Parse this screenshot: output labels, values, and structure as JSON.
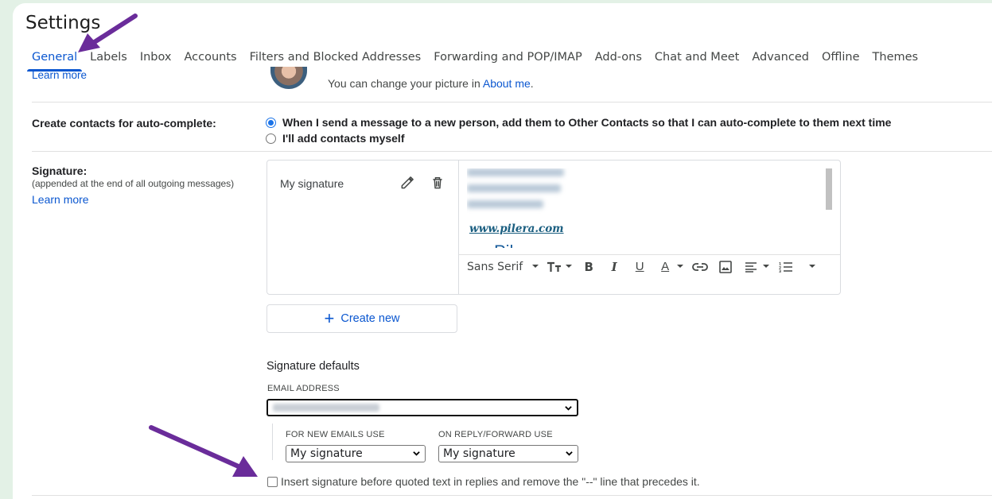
{
  "header": {
    "title": "Settings"
  },
  "tabs": [
    {
      "label": "General",
      "active": true
    },
    {
      "label": "Labels"
    },
    {
      "label": "Inbox"
    },
    {
      "label": "Accounts"
    },
    {
      "label": "Filters and Blocked Addresses"
    },
    {
      "label": "Forwarding and POP/IMAP"
    },
    {
      "label": "Add-ons"
    },
    {
      "label": "Chat and Meet"
    },
    {
      "label": "Advanced"
    },
    {
      "label": "Offline"
    },
    {
      "label": "Themes"
    }
  ],
  "picture": {
    "learn_more": "Learn more",
    "change_text": "You can change your picture in ",
    "about_me": "About me",
    "period": "."
  },
  "autocomplete": {
    "label": "Create contacts for auto-complete:",
    "option_auto": "When I send a message to a new person, add them to Other Contacts so that I can auto-complete to them next time",
    "option_manual": "I'll add contacts myself"
  },
  "signature": {
    "label": "Signature:",
    "sublabel": "(appended at the end of all outgoing messages)",
    "learn_more": "Learn more",
    "item_name": "My signature",
    "website": "www.pilera.com",
    "logo_text": "Pilera",
    "font_name": "Sans Serif",
    "create_new": "Create new"
  },
  "defaults": {
    "title": "Signature defaults",
    "email_label": "EMAIL ADDRESS",
    "new_label": "FOR NEW EMAILS USE",
    "reply_label": "ON REPLY/FORWARD USE",
    "new_value": "My signature",
    "reply_value": "My signature",
    "insert_before": "Insert signature before quoted text in replies and remove the \"--\" line that precedes it."
  },
  "colors": {
    "accent": "#0b57d0",
    "annotation_arrow": "#6a2c9a",
    "background": "#e3f1e6"
  }
}
